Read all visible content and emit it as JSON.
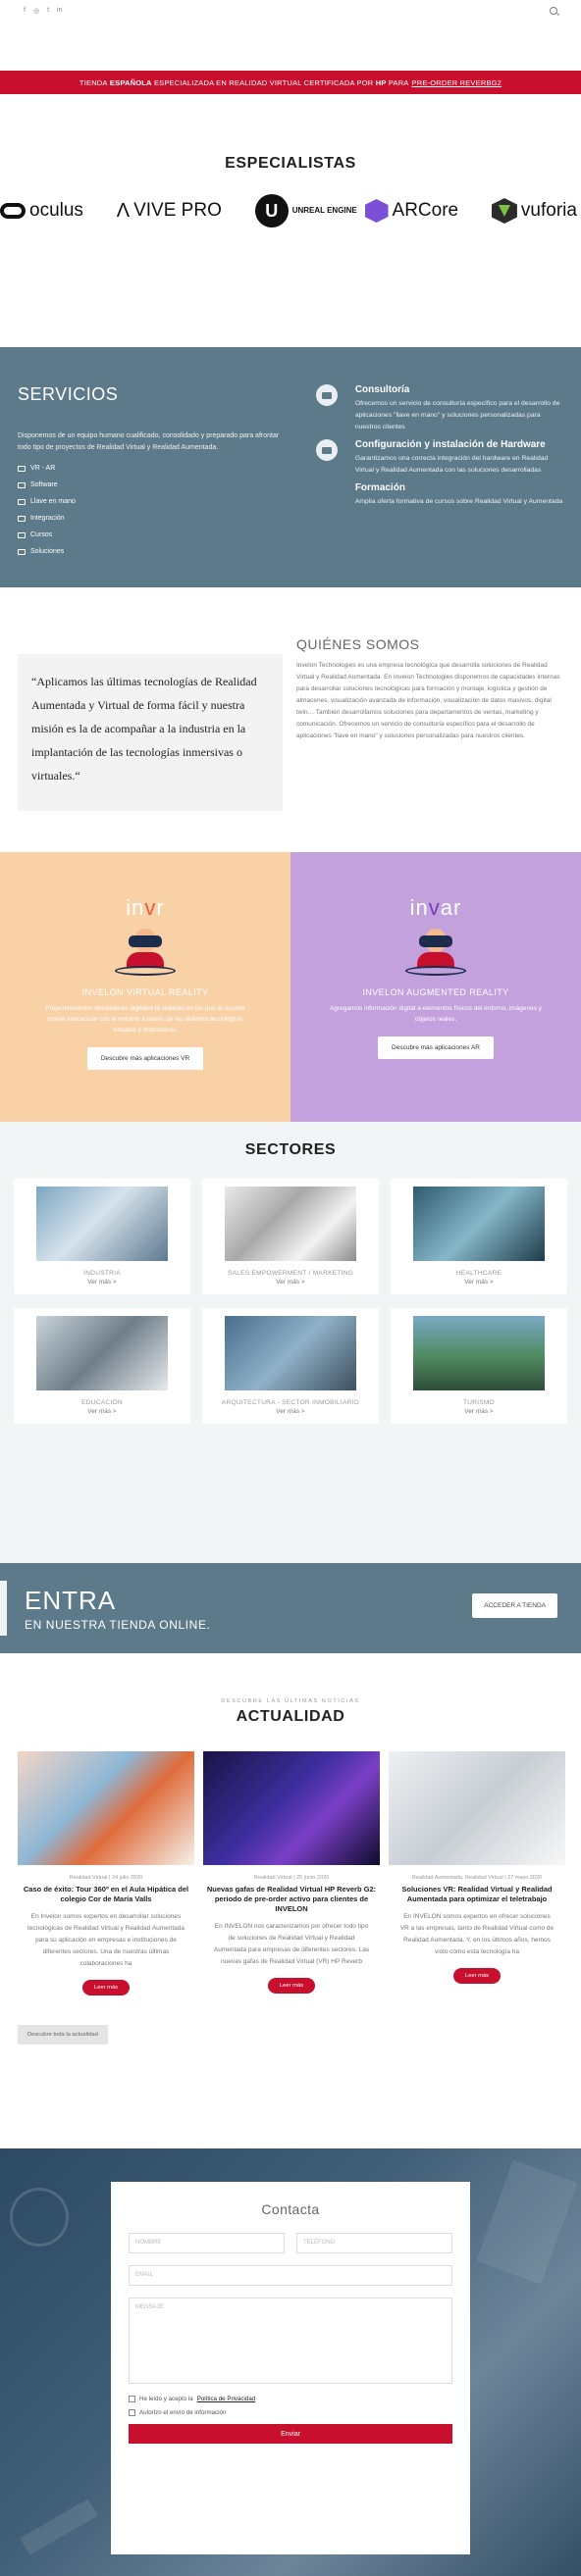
{
  "topbar": {
    "socials": [
      "f",
      "◎",
      "t",
      "in"
    ]
  },
  "promo": {
    "prefix": "TIENDA",
    "brand": "ESPAÑOLA",
    "middle": "ESPECIALIZADA EN REALIDAD VIRTUAL CERTIFICADA POR",
    "hp": "HP",
    "para": "PARA",
    "link": "PRE-ORDER REVERBG2"
  },
  "especialistas": {
    "title": "ESPECIALISTAS",
    "logos": [
      "oculus",
      "VIVE PRO",
      "UNREAL ENGINE",
      "ARCore",
      "vuforia"
    ]
  },
  "servicios": {
    "title": "SERVICIOS",
    "intro": "Disponemos de un equipo humano cualificado, consolidado y preparado para afrontar todo tipo de proyectos de Realidad Virtual y Realidad Aumentada.",
    "list": [
      "VR - AR",
      "Software",
      "Llave en mano",
      "Integración",
      "Cursos",
      "Soluciones"
    ],
    "items": [
      {
        "title": "Consultoría",
        "text": "Ofrecemos un servicio de consultoría específico para el desarrollo de aplicaciones \"llave en mano\" y soluciones personalizadas para nuestros clientes"
      },
      {
        "title": "Configuración y instalación de Hardware",
        "text": "Garantizamos una correcta integración del hardware en Realidad Virtual y Realidad Aumentada con las soluciones desarrolladas"
      },
      {
        "title": "Formación",
        "text": "Amplia oferta formativa de cursos sobre Realidad Virtual y Aumentada"
      }
    ]
  },
  "quienes": {
    "quote": "“Aplicamos las últimas tecnologías de Realidad Aumentada y Virtual de forma fácil y nuestra misión es la de acompañar a la industria en la implantación de las tecnologías inmersivas o virtuales.“",
    "title": "QUIÉNES SOMOS",
    "text": "Invelon Technologies es una empresa tecnológica que desarrolla soluciones de Realidad Virtual y Realidad Aumentada. En Invelon Technologies disponemos de capacidades internas para desarrollar soluciones tecnológicas para formación y montaje, logística y gestión de almacenes, visualización avanzada de información, visualización de datos masivos, digital twin… También desarrollamos soluciones para departamentos de ventas, marketing y comunicación. Ofrecemos un servicio de consultoría específico para el desarrollo de aplicaciones \"llave en mano\" y soluciones personalizadas para nuestros clientes."
  },
  "invelon": {
    "vr": {
      "logo_a": "in",
      "logo_b": "v",
      "logo_c": "r",
      "title": "INVELON VIRTUAL REALITY",
      "text": "Proporcionamos simuladores digitales la realidad en los que el usuario puede interactuar con el entorno a través de las distintas tecnologías virtuales y dispositivos.",
      "button": "Descubre más aplicaciones VR"
    },
    "ar": {
      "logo_a": "in",
      "logo_b": "v",
      "logo_c": "ar",
      "title": "INVELON AUGMENTED REALITY",
      "text": "Agregamos información digital a elementos físicos del entorno, imágenes y objetos reales.",
      "button": "Descubre más aplicaciones AR"
    }
  },
  "sectores": {
    "title": "SECTORES",
    "more": "Ver más >",
    "items": [
      {
        "name": "INDUSTRIA"
      },
      {
        "name": "SALES EMPOWERMENT / MARKETING"
      },
      {
        "name": "HEALTHCARE"
      },
      {
        "name": "EDUCACIÓN"
      },
      {
        "name": "ARQUITECTURA - SECTOR INMOBILIARIO"
      },
      {
        "name": "TURISMO"
      }
    ]
  },
  "entra": {
    "title": "ENTRA",
    "subtitle": "EN NUESTRA TIENDA ONLINE.",
    "button": "ACCEDER A TIENDA"
  },
  "actualidad": {
    "kicker": "DESCUBRE LAS ÚLTIMAS NOTICIAS",
    "title": "ACTUALIDAD",
    "read_more": "Leer más",
    "discover": "Descubre toda la actualidad",
    "posts": [
      {
        "meta": "Realidad Virtual  |  24 julio 2020",
        "title": "Caso de éxito: Tour 360º en el Aula Hipática del colegio Cor de María Valls",
        "text": "En Invelon somos expertos en desarrollar soluciones tecnológicas de Realidad Virtual y Realidad Aumentada para su aplicación en empresas e instituciones de diferentes sectores. Una de nuestras últimas colaboraciones ha"
      },
      {
        "meta": "Realidad Virtual  |  25 junio 2020",
        "title": "Nuevas gafas de Realidad Virtual HP Reverb G2: periodo de pre-order activo para clientes de INVELON",
        "text": "En INVELON nos caracterizamos por ofrecer todo tipo de soluciones de Realidad Virtual y Realidad Aumentada para empresas de diferentes sectores. Las nuevas gafas de Realidad Virtual (VR) HP Reverb"
      },
      {
        "meta": "Realidad Aumentada, Realidad Virtual  |  27 mayo 2020",
        "title": "Soluciones VR: Realidad Virtual y Realidad Aumentada para optimizar el teletrabajo",
        "text": "En INVELON somos expertos en ofrecer soluciones VR a las empresas, tanto de Realidad Virtual como de Realidad Aumentada. Y, en los últimos años, hemos visto cómo esta tecnología ha"
      }
    ]
  },
  "contacta": {
    "title": "Contacta",
    "nombre": "NOMBRE",
    "telefono": "TELÉFONO",
    "email": "EMAIL",
    "mensaje": "MENSAJE",
    "privacy_prefix": "He leído y acepto la",
    "privacy_link": "Política de Privacidad",
    "authorize": "Autorizo el envío de información",
    "submit": "Enviar"
  },
  "colors": {
    "brand_red": "#c8102e",
    "slate": "#5c7a89",
    "vr_bg": "#f9d1a7",
    "ar_bg": "#c2a1dd"
  }
}
